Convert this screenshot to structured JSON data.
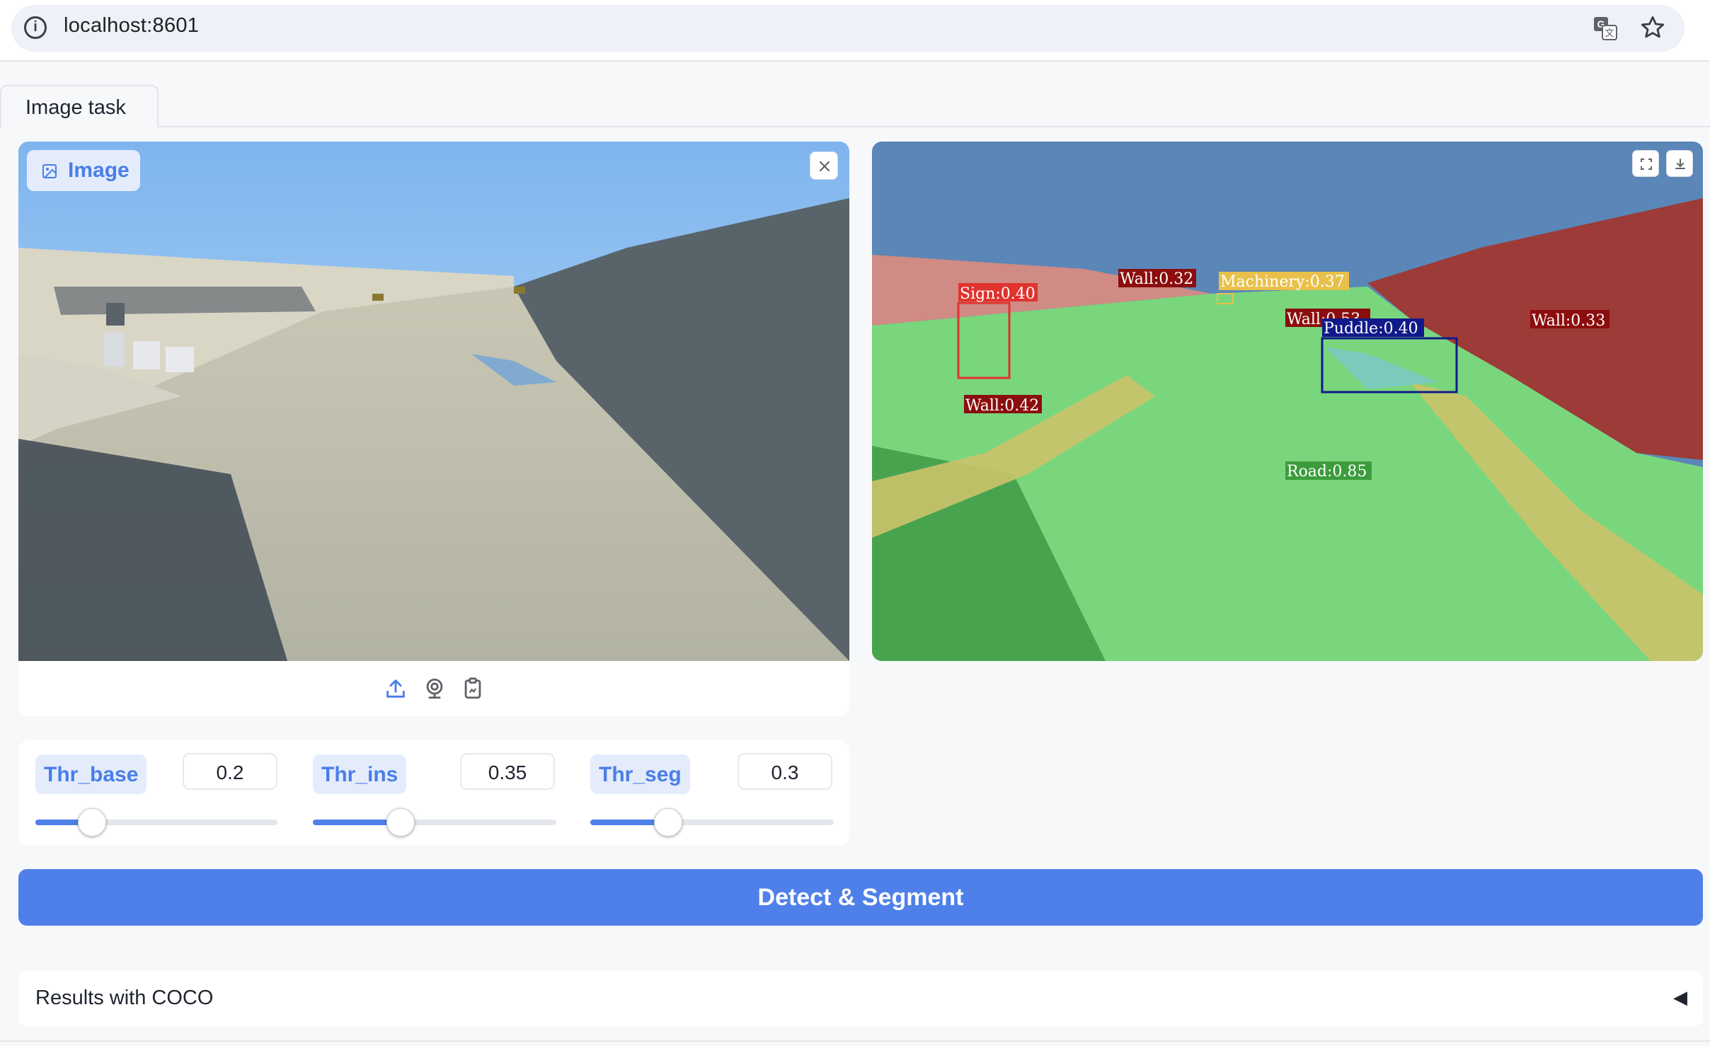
{
  "browser": {
    "url": "localhost:8601"
  },
  "tabs": [
    {
      "label": "Image task"
    }
  ],
  "input_image": {
    "badge_label": "Image"
  },
  "sliders": [
    {
      "label": "Thr_base",
      "value": "0.2",
      "fraction": 0.2
    },
    {
      "label": "Thr_ins",
      "value": "0.35",
      "fraction": 0.35
    },
    {
      "label": "Thr_seg",
      "value": "0.3",
      "fraction": 0.3
    }
  ],
  "submit_label": "Detect & Segment",
  "accordion": {
    "label": "Results with COCO",
    "arrow": "◀"
  },
  "detections": [
    {
      "label": "Sign:0.40",
      "color": "#e0332e"
    },
    {
      "label": "Wall:0.32",
      "color": "#8b0d0d"
    },
    {
      "label": "Machinery:0.37",
      "color": "#e8c04a"
    },
    {
      "label": "Wall:0.53",
      "color": "#8b0d0d"
    },
    {
      "label": "Puddle:0.40",
      "color": "#101a8a"
    },
    {
      "label": "Wall:0.33",
      "color": "#8b0d0d"
    },
    {
      "label": "Wall:0.42",
      "color": "#8b0d0d"
    },
    {
      "label": "Road:0.85",
      "color": "#3c9c3c"
    }
  ],
  "colors": {
    "accent": "#4f80ea",
    "badge_bg": "#e4ecfc"
  }
}
